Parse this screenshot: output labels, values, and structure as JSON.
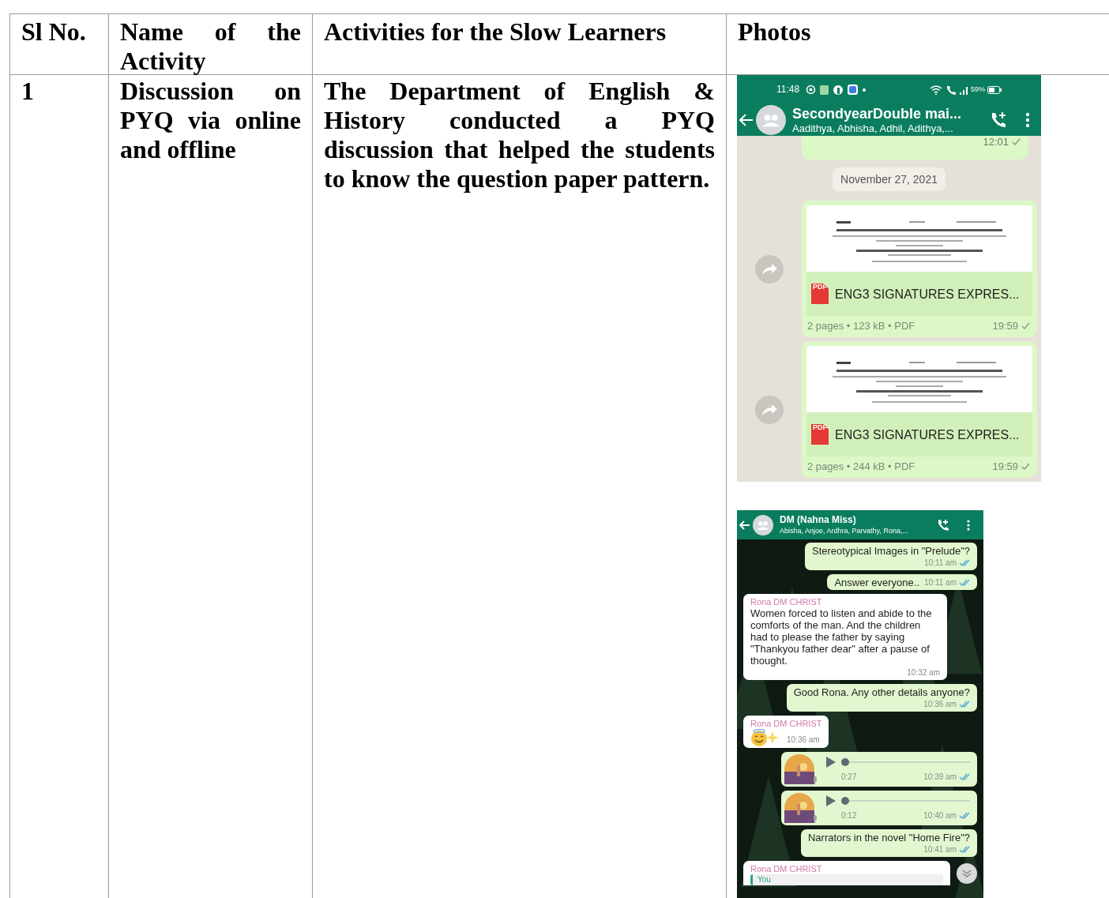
{
  "table": {
    "columns": [
      "Sl No.",
      "Name of the Activity",
      "Activities for the Slow Learners",
      "Photos"
    ],
    "rows": [
      {
        "sl_no": "1",
        "activity": "Discussion on PYQ via online and offline",
        "description": "The Department of English & History conducted a PYQ discussion that helped the students to know the question paper pattern.",
        "photos": [
          {
            "kind": "files_chat",
            "status_bar": {
              "time": "11:48",
              "battery": "59%"
            },
            "header": {
              "title": "SecondyearDouble mai...",
              "subtitle": "Aadithya, Abhisha, Adhil, Adithya,..."
            },
            "messages": [
              {
                "kind": "tail",
                "time": "12:01",
                "read": false
              },
              {
                "kind": "date",
                "text": "November 27, 2021"
              },
              {
                "kind": "document",
                "icon_label": "PDF",
                "filename": "ENG3 SIGNATURES EXPRES...",
                "meta": "2 pages • 123 kB • PDF",
                "time": "19:59",
                "read": false
              },
              {
                "kind": "document",
                "icon_label": "PDF",
                "filename": "ENG3 SIGNATURES EXPRES...",
                "meta": "2 pages • 244 kB • PDF",
                "time": "19:59",
                "read": false
              }
            ]
          },
          {
            "kind": "text_chat",
            "header": {
              "title": "DM (Nahna Miss)",
              "subtitle": "Abisha, Anjoe, Ardhra, Parvathy, Rona,..."
            },
            "messages": [
              {
                "kind": "text",
                "outgoing": true,
                "text": "Stereotypical Images in \"Prelude\"?",
                "time": "10:11 am",
                "read": true
              },
              {
                "kind": "short_text",
                "outgoing": true,
                "text": "Answer everyone..",
                "time": "10:11 am",
                "read": true
              },
              {
                "kind": "text",
                "outgoing": false,
                "sender": "Rona DM CHRIST",
                "text": "Women forced to listen and abide to the comforts of the man. And the children had to please the father by saying \"Thankyou father dear\" after a pause of thought.",
                "time": "10:32 am"
              },
              {
                "kind": "text",
                "outgoing": true,
                "text": "Good Rona. Any other details anyone?",
                "time": "10:36 am",
                "read": true
              },
              {
                "kind": "emoji",
                "outgoing": false,
                "sender": "Rona DM CHRIST",
                "time": "10:36 am"
              },
              {
                "kind": "voice",
                "outgoing": true,
                "duration": "0:27",
                "level": 0,
                "time": "10:39 am",
                "read": true
              },
              {
                "kind": "voice",
                "outgoing": true,
                "duration": "0:12",
                "level": 0,
                "time": "10:40 am",
                "read": true
              },
              {
                "kind": "text",
                "outgoing": true,
                "text": "Narrators in the novel \"Home Fire\"?",
                "time": "10:41 am",
                "read": true
              },
              {
                "kind": "reply",
                "outgoing": false,
                "sender": "Rona DM CHRIST",
                "quote_author": "You"
              }
            ]
          }
        ]
      }
    ]
  }
}
